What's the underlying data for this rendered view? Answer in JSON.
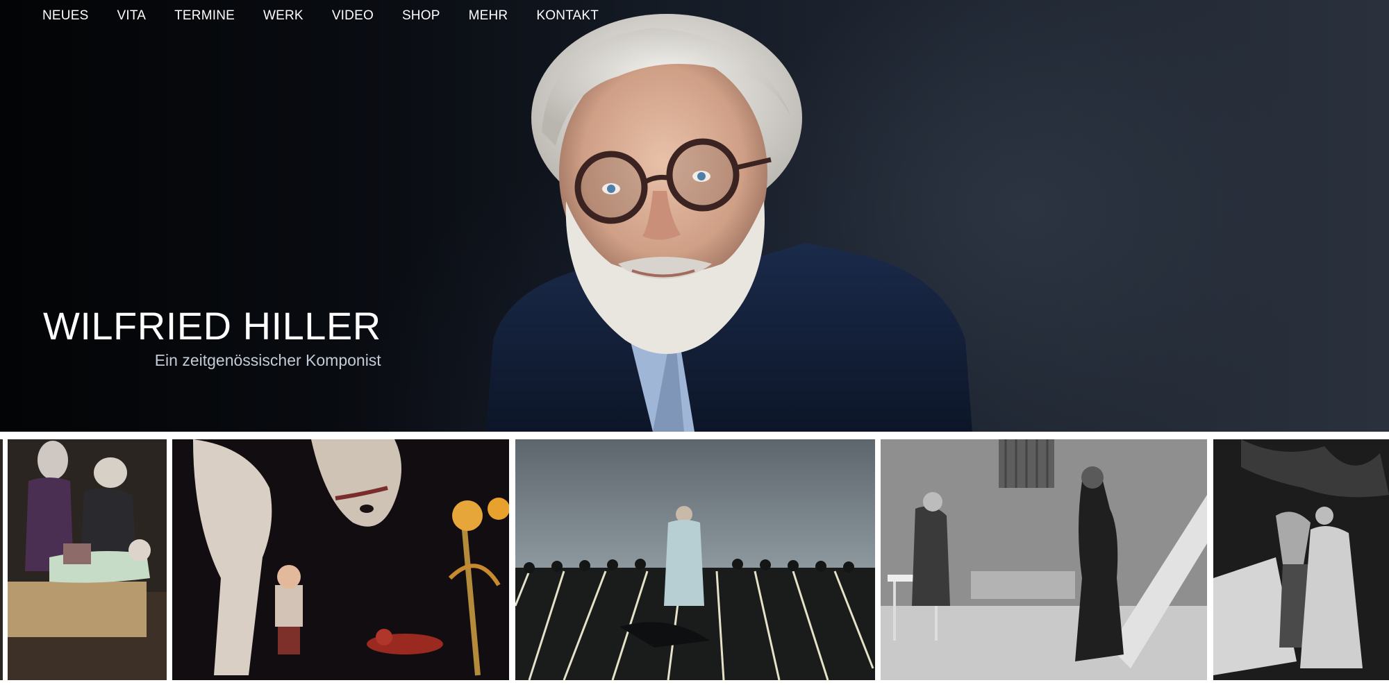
{
  "nav": {
    "items": [
      {
        "label": "NEUES"
      },
      {
        "label": "VITA"
      },
      {
        "label": "TERMINE"
      },
      {
        "label": "WERK"
      },
      {
        "label": "VIDEO"
      },
      {
        "label": "SHOP"
      },
      {
        "label": "MEHR"
      },
      {
        "label": "KONTAKT"
      }
    ]
  },
  "hero": {
    "title": "WILFRIED HILLER",
    "subtitle": "Ein zeitgenössischer Komponist"
  },
  "colors": {
    "nav_text": "#ffffff",
    "subtitle_text": "#c3cbd6",
    "hero_background": "#141a24",
    "gallery_background": "#ffffff"
  },
  "gallery": {
    "thumbnails": [
      {
        "name": "stage-photo-baroque-figures"
      },
      {
        "name": "stage-photo-horse-and-puppet"
      },
      {
        "name": "stage-photo-singer-light-stripes"
      },
      {
        "name": "stage-photo-bw-costume-stairs"
      },
      {
        "name": "stage-photo-bw-masked-dancers"
      }
    ]
  }
}
